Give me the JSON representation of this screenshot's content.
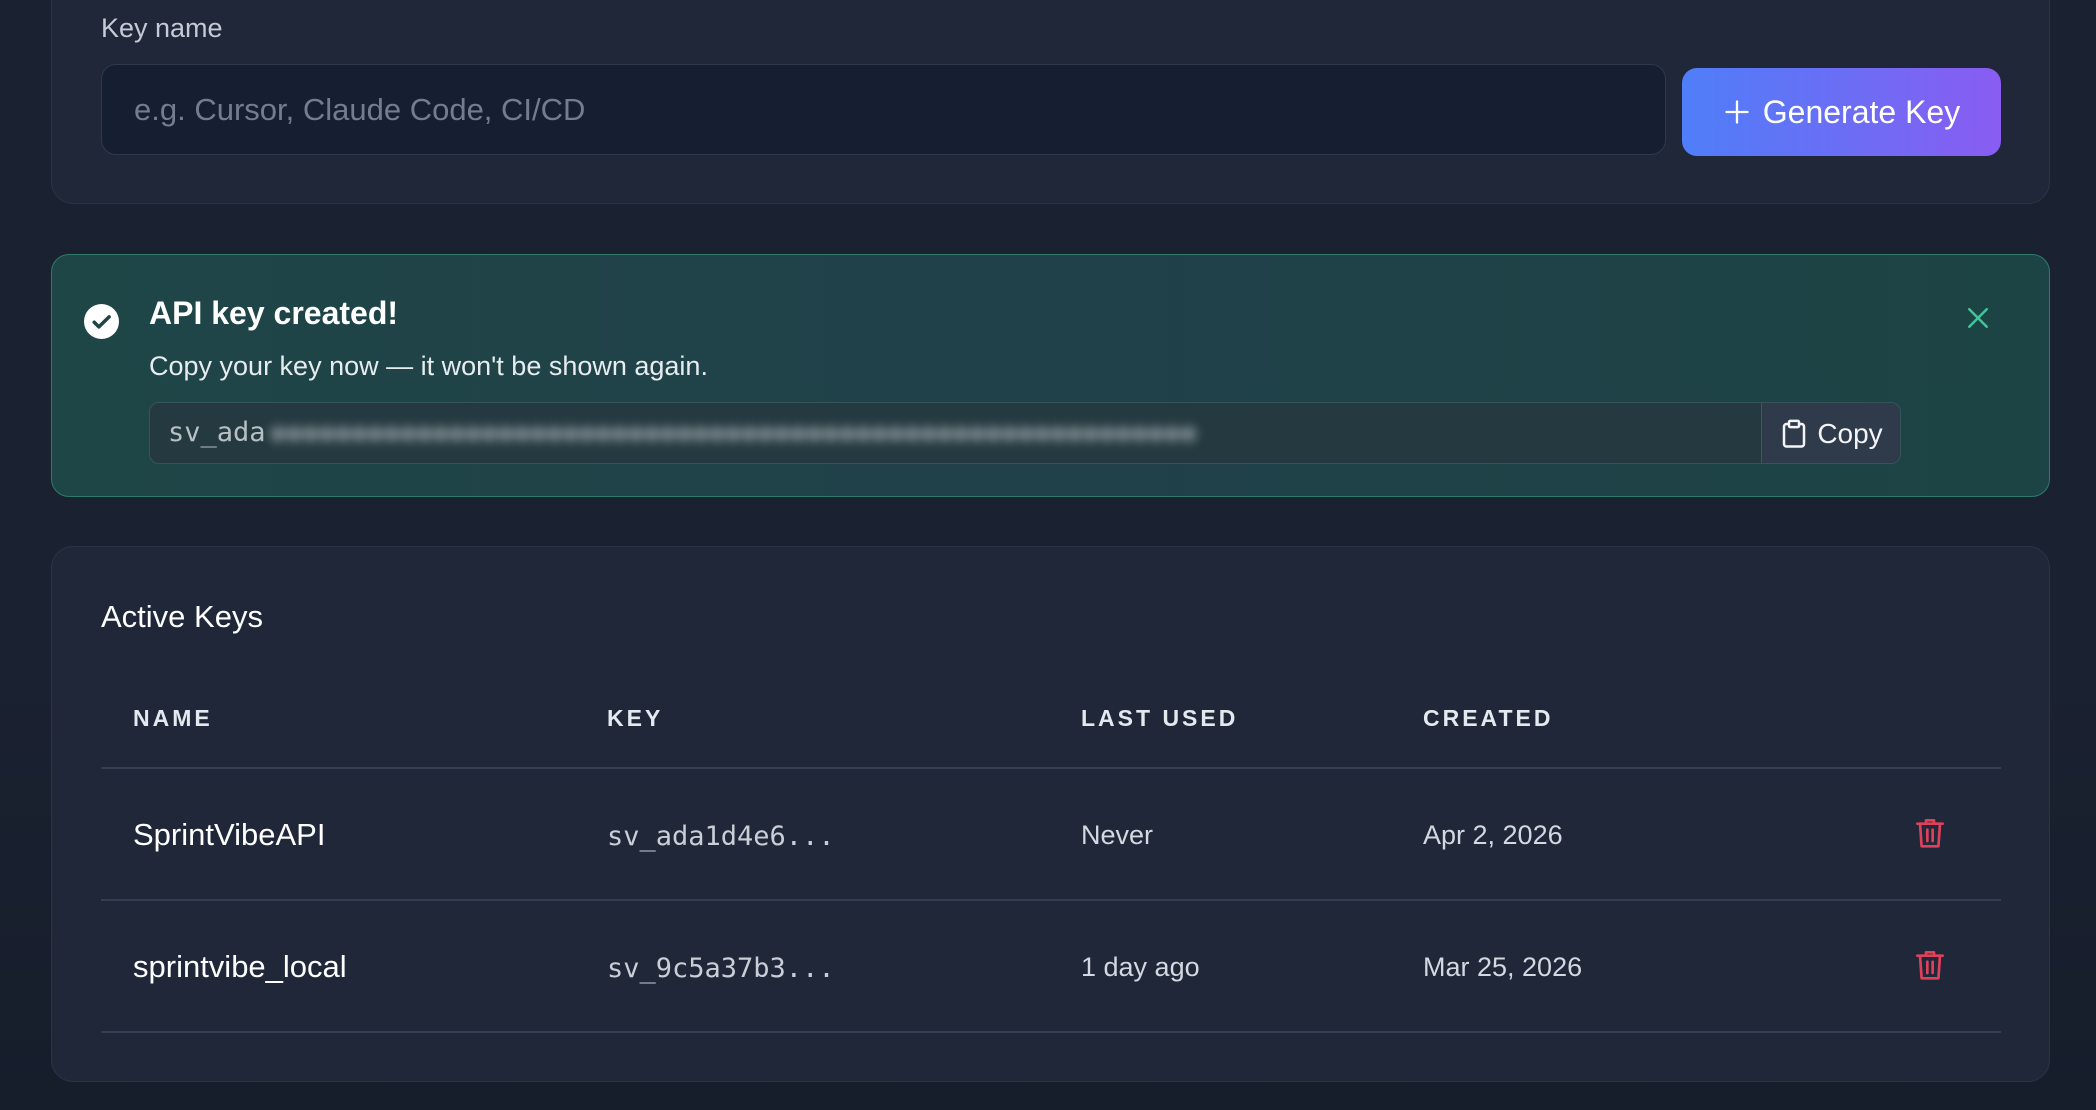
{
  "form": {
    "key_name_label": "Key name",
    "key_name_placeholder": "e.g. Cursor, Claude Code, CI/CD",
    "key_name_value": "",
    "generate_button_label": "Generate Key"
  },
  "banner": {
    "title": "API key created!",
    "subtitle": "Copy your key now — it won't be shown again.",
    "key_visible_prefix": "sv_ada",
    "copy_button_label": "Copy",
    "icons": {
      "status": "check-circle-icon",
      "close": "close-icon",
      "copy": "clipboard-icon"
    }
  },
  "active_keys": {
    "title": "Active Keys",
    "columns": {
      "name": "NAME",
      "key": "KEY",
      "last_used": "LAST USED",
      "created": "CREATED"
    },
    "rows": [
      {
        "name": "SprintVibeAPI",
        "key": "sv_ada1d4e6...",
        "last_used": "Never",
        "created": "Apr 2, 2026"
      },
      {
        "name": "sprintvibe_local",
        "key": "sv_9c5a37b3...",
        "last_used": "1 day ago",
        "created": "Mar 25, 2026"
      }
    ],
    "row_action_icon": "trash-icon"
  },
  "colors": {
    "accent_gradient_start": "#4f7ef8",
    "accent_gradient_end": "#8a5cf2",
    "success_border": "#2f7a68",
    "success_icon": "#3fc79a",
    "danger": "#e0415a",
    "background": "#1a2130",
    "card": "#1f2739"
  }
}
